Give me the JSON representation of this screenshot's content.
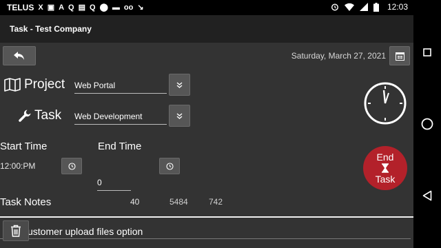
{
  "status_bar": {
    "carrier": "TELUS",
    "time": "12:03",
    "left_icons": [
      "x-icon",
      "image-icon",
      "handwriting-icon",
      "q-icon",
      "q-icon",
      "location-icon",
      "folder-icon",
      "voicemail-icon",
      "call-missed-icon"
    ],
    "left_glyphs": [
      "X",
      "▣",
      "A",
      "Q",
      "▤",
      "Q",
      "⬤",
      "▬",
      "oo",
      "↘"
    ],
    "right_icons": [
      "alarm-icon",
      "wifi-icon",
      "signal-icon",
      "battery-icon"
    ]
  },
  "app_bar": {
    "title": "Task - Test Company"
  },
  "header": {
    "date": "Saturday, March 27, 2021"
  },
  "project": {
    "label": "Project",
    "value": "Web Portal"
  },
  "task": {
    "label": "Task",
    "value": "Web Development"
  },
  "times": {
    "start_label": "Start Time",
    "end_label": "End Time",
    "start_value": "12:00:PM",
    "end_value": "",
    "duration_value": "0"
  },
  "notes": {
    "label": "Task Notes",
    "counts": [
      "40",
      "5484",
      "742"
    ],
    "text": "ustomer upload files option"
  },
  "end_button": {
    "line1": "End",
    "line2": "Task"
  },
  "colors": {
    "accent_red": "#b3212a",
    "background": "#333333",
    "appbar": "#212121"
  }
}
